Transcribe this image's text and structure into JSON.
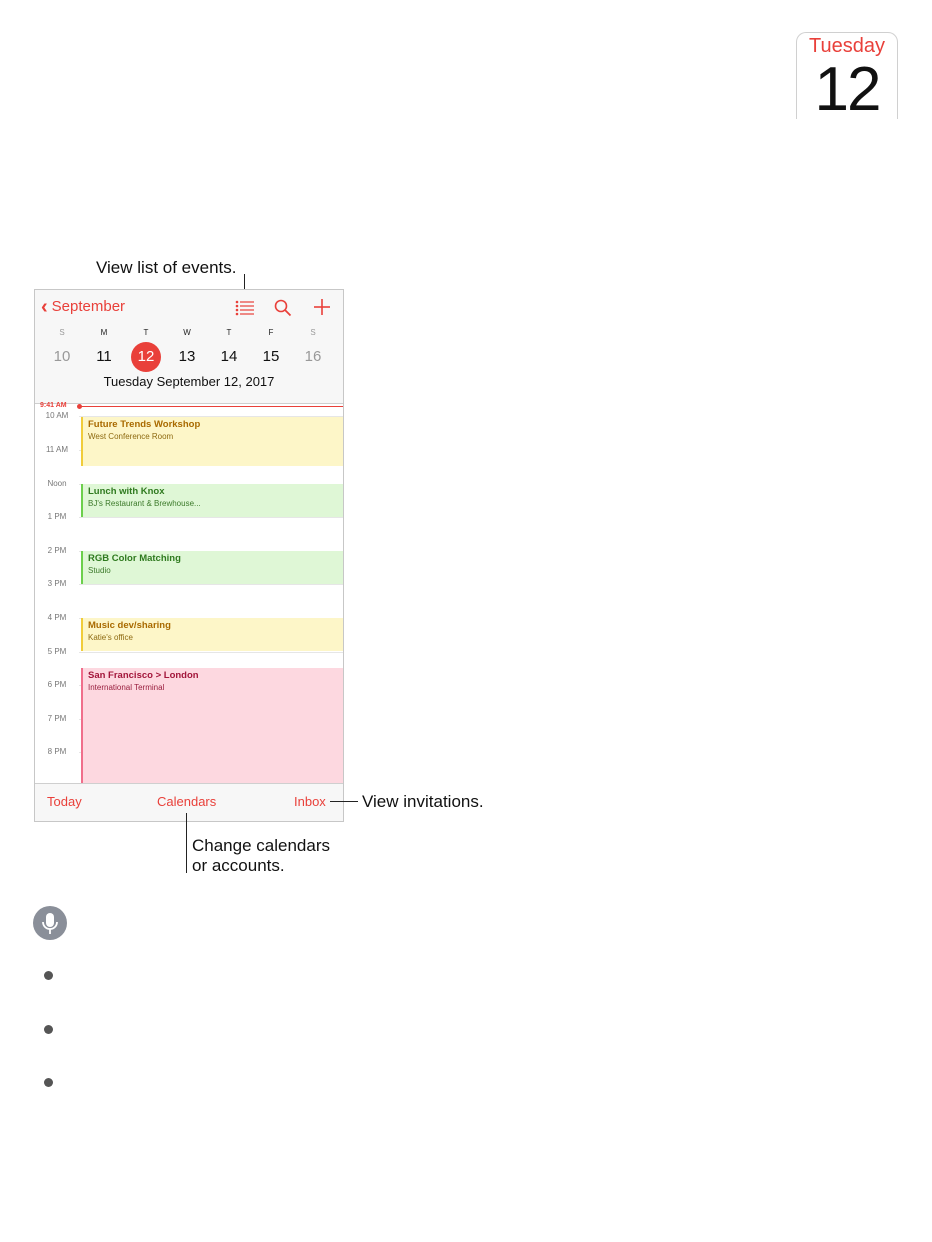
{
  "app_icon": {
    "day": "Tuesday",
    "date": "12"
  },
  "callouts": {
    "list": "View list of events.",
    "invitations": "View invitations.",
    "calendars_line1": "Change calendars",
    "calendars_line2": "or accounts."
  },
  "header": {
    "back_label": "September"
  },
  "week": {
    "letters": [
      "S",
      "M",
      "T",
      "W",
      "T",
      "F",
      "S"
    ],
    "days": [
      "10",
      "11",
      "12",
      "13",
      "14",
      "15",
      "16"
    ],
    "selected": "12",
    "date_line": "Tuesday  September 12, 2017"
  },
  "now_time": "9:41 AM",
  "hours": [
    "10 AM",
    "11 AM",
    "Noon",
    "1 PM",
    "2 PM",
    "3 PM",
    "4 PM",
    "5 PM",
    "6 PM",
    "7 PM",
    "8 PM"
  ],
  "events": [
    {
      "title": "Future Trends Workshop",
      "subtitle": "West Conference Room",
      "color": "yellow"
    },
    {
      "title": "Lunch with Knox",
      "subtitle": "BJ's Restaurant & Brewhouse...",
      "color": "green"
    },
    {
      "title": "RGB Color Matching",
      "subtitle": "Studio",
      "color": "green"
    },
    {
      "title": "Music dev/sharing",
      "subtitle": "Katie's office",
      "color": "yellow"
    },
    {
      "title": "San Francisco > London",
      "subtitle": "International Terminal",
      "color": "pink"
    }
  ],
  "tabs": {
    "today": "Today",
    "calendars": "Calendars",
    "inbox": "Inbox"
  },
  "colors": {
    "accent": "#e9403a"
  },
  "icons": [
    "list-icon",
    "search-icon",
    "add-icon",
    "chevron-left-icon",
    "microphone-icon"
  ]
}
